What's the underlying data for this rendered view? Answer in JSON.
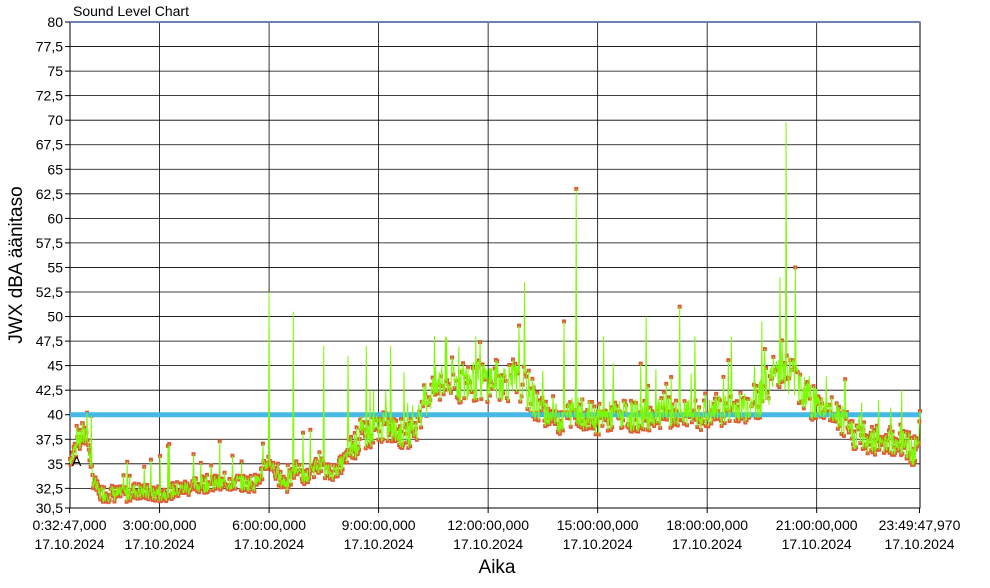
{
  "chart_data": {
    "type": "line",
    "title": "Sound Level Chart",
    "xlabel": "Aika",
    "ylabel": "JWX dBA äänitaso",
    "ylim": [
      30.5,
      80
    ],
    "y_ticks": [
      "80",
      "77,5",
      "75",
      "72,5",
      "70",
      "67,5",
      "65",
      "62,5",
      "60",
      "57,5",
      "55",
      "52,5",
      "50",
      "47,5",
      "45",
      "42,5",
      "40",
      "37,5",
      "35",
      "32,5",
      "30,5"
    ],
    "x_ticks": [
      {
        "time": "0:32:47,000",
        "date": "17.10.2024"
      },
      {
        "time": "3:00:00,000",
        "date": "17.10.2024"
      },
      {
        "time": "6:00:00,000",
        "date": "17.10.2024"
      },
      {
        "time": "9:00:00,000",
        "date": "17.10.2024"
      },
      {
        "time": "12:00:00,000",
        "date": "17.10.2024"
      },
      {
        "time": "15:00:00,000",
        "date": "17.10.2024"
      },
      {
        "time": "18:00:00,000",
        "date": "17.10.2024"
      },
      {
        "time": "21:00:00,000",
        "date": "17.10.2024"
      },
      {
        "time": "23:49:47,970",
        "date": "17.10.2024"
      }
    ],
    "grid": true,
    "threshold": {
      "value": 40,
      "color": "#45b8e8"
    },
    "marker_label": "A",
    "series": [
      {
        "color": "#7cfc00",
        "marker_color": "#e05a3a",
        "points": [
          [
            "0:32:47",
            35.5
          ],
          [
            "0:45",
            37.0
          ],
          [
            "1:00",
            38.5
          ],
          [
            "1:10",
            33.5
          ],
          [
            "1:20",
            32.0
          ],
          [
            "1:40",
            32.0
          ],
          [
            "2:00",
            31.8
          ],
          [
            "2:20",
            32.3
          ],
          [
            "2:40",
            32.0
          ],
          [
            "3:00",
            32.0
          ],
          [
            "3:20",
            32.2
          ],
          [
            "3:40",
            32.5
          ],
          [
            "4:00",
            32.8
          ],
          [
            "4:20",
            33.0
          ],
          [
            "4:40",
            32.9
          ],
          [
            "5:00",
            33.2
          ],
          [
            "5:20",
            33.0
          ],
          [
            "5:40",
            33.1
          ],
          [
            "6:00",
            35.5
          ],
          [
            "6:15",
            33.5
          ],
          [
            "6:30",
            33.0
          ],
          [
            "6:45",
            34.5
          ],
          [
            "7:00",
            33.5
          ],
          [
            "7:20",
            35.0
          ],
          [
            "7:40",
            34.0
          ],
          [
            "8:00",
            35.0
          ],
          [
            "8:20",
            37.0
          ],
          [
            "8:40",
            38.0
          ],
          [
            "9:00",
            38.8
          ],
          [
            "9:20",
            38.5
          ],
          [
            "9:40",
            38.0
          ],
          [
            "10:00",
            38.5
          ],
          [
            "10:20",
            42.0
          ],
          [
            "10:40",
            43.0
          ],
          [
            "11:00",
            43.2
          ],
          [
            "11:30",
            43.5
          ],
          [
            "12:00",
            43.5
          ],
          [
            "12:30",
            43.5
          ],
          [
            "13:00",
            43.0
          ],
          [
            "13:20",
            41.0
          ],
          [
            "13:40",
            40.0
          ],
          [
            "14:00",
            39.5
          ],
          [
            "14:20",
            40.5
          ],
          [
            "14:40",
            40.0
          ],
          [
            "15:00",
            39.5
          ],
          [
            "15:30",
            40.0
          ],
          [
            "16:00",
            39.8
          ],
          [
            "16:30",
            40.0
          ],
          [
            "17:00",
            40.2
          ],
          [
            "17:30",
            40.0
          ],
          [
            "18:00",
            40.0
          ],
          [
            "18:30",
            40.5
          ],
          [
            "19:00",
            41.0
          ],
          [
            "19:30",
            42.0
          ],
          [
            "20:00",
            45.0
          ],
          [
            "20:20",
            44.0
          ],
          [
            "20:40",
            42.5
          ],
          [
            "21:00",
            41.0
          ],
          [
            "21:20",
            40.5
          ],
          [
            "21:40",
            39.5
          ],
          [
            "22:00",
            38.0
          ],
          [
            "22:30",
            37.5
          ],
          [
            "23:00",
            37.5
          ],
          [
            "23:20",
            37.0
          ],
          [
            "23:49:47",
            36.0
          ]
        ]
      }
    ],
    "peaks": [
      [
        "6:00",
        52.5
      ],
      [
        "6:40",
        50.5
      ],
      [
        "7:30",
        47.0
      ],
      [
        "8:10",
        46.0
      ],
      [
        "8:40",
        47.0
      ],
      [
        "9:20",
        47.0
      ],
      [
        "10:50",
        48.0
      ],
      [
        "11:40",
        48.0
      ],
      [
        "13:00",
        53.5
      ],
      [
        "14:05",
        49.5
      ],
      [
        "14:25",
        63.0
      ],
      [
        "15:10",
        48.0
      ],
      [
        "16:20",
        50.0
      ],
      [
        "17:15",
        51.0
      ],
      [
        "17:40",
        48.0
      ],
      [
        "18:40",
        48.0
      ],
      [
        "19:30",
        49.5
      ],
      [
        "20:00",
        54.0
      ],
      [
        "20:10",
        69.8
      ],
      [
        "20:25",
        55.0
      ],
      [
        "22:10",
        40.0
      ],
      [
        "23:20",
        42.5
      ]
    ]
  }
}
